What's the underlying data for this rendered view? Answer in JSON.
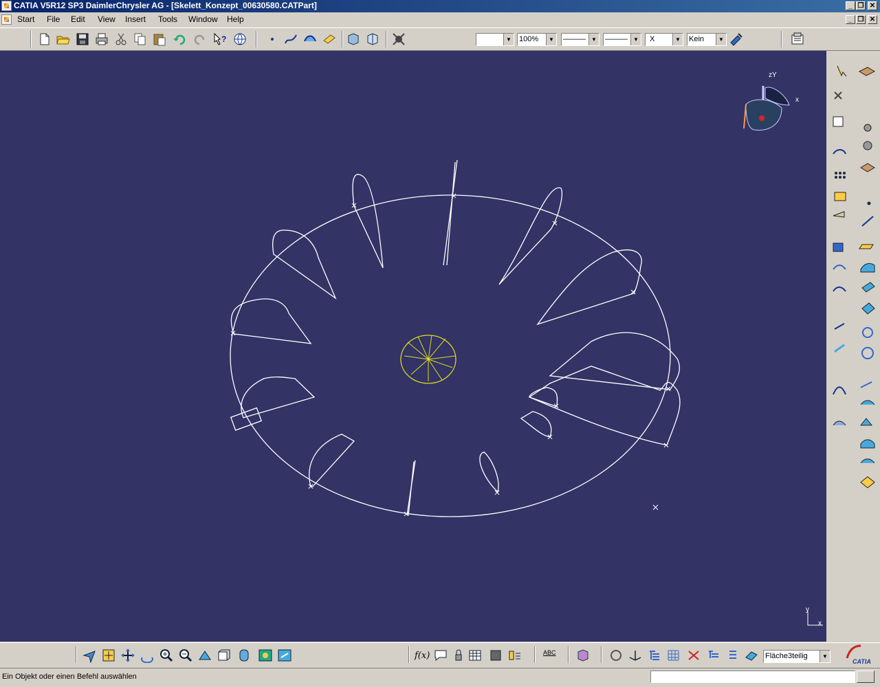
{
  "window": {
    "title": "CATIA V5R12 SP3 DaimlerChrysler AG - [Skelett_Konzept_00630580.CATPart]",
    "controls": {
      "minimize": "_",
      "restore": "❐",
      "close": "✕"
    }
  },
  "menubar": {
    "items": [
      {
        "label": "Start",
        "mnemonic": "S"
      },
      {
        "label": "File",
        "mnemonic": "F"
      },
      {
        "label": "Edit",
        "mnemonic": "E"
      },
      {
        "label": "View",
        "mnemonic": "V"
      },
      {
        "label": "Insert",
        "mnemonic": "I"
      },
      {
        "label": "Tools",
        "mnemonic": "T"
      },
      {
        "label": "Window",
        "mnemonic": "W"
      },
      {
        "label": "Help",
        "mnemonic": "H"
      }
    ]
  },
  "toolbar": {
    "zoom_value": "100%",
    "line_type": "———",
    "line_thickness": "———",
    "point_style": "X",
    "layer": "Kein",
    "icons": [
      "new-icon",
      "open-icon",
      "save-icon",
      "print-icon",
      "cut-icon",
      "copy-icon",
      "paste-icon",
      "undo-icon",
      "redo-icon",
      "whats-this-icon",
      "catalog-icon",
      "point-icon",
      "spline-icon",
      "sweep-icon",
      "measure-icon",
      "part-body-icon",
      "geometrical-set-icon",
      "mesh-icon",
      "format-painter-icon",
      "properties-icon"
    ]
  },
  "viewport": {
    "background": "#333366",
    "geometry_color": "#ffffff",
    "highlight_color": "#dddd22",
    "compass": {
      "axis_z": "zY",
      "axis_x": "x"
    },
    "axis_indicator": {
      "y": "y",
      "x": "x"
    }
  },
  "bottom_toolbar": {
    "body_selector": "Fläche3teilig",
    "formula_label": "f(x)",
    "spell_label": "ABC"
  },
  "status": {
    "message": "Ein Objekt oder einen Befehl auswählen",
    "command_value": ""
  }
}
